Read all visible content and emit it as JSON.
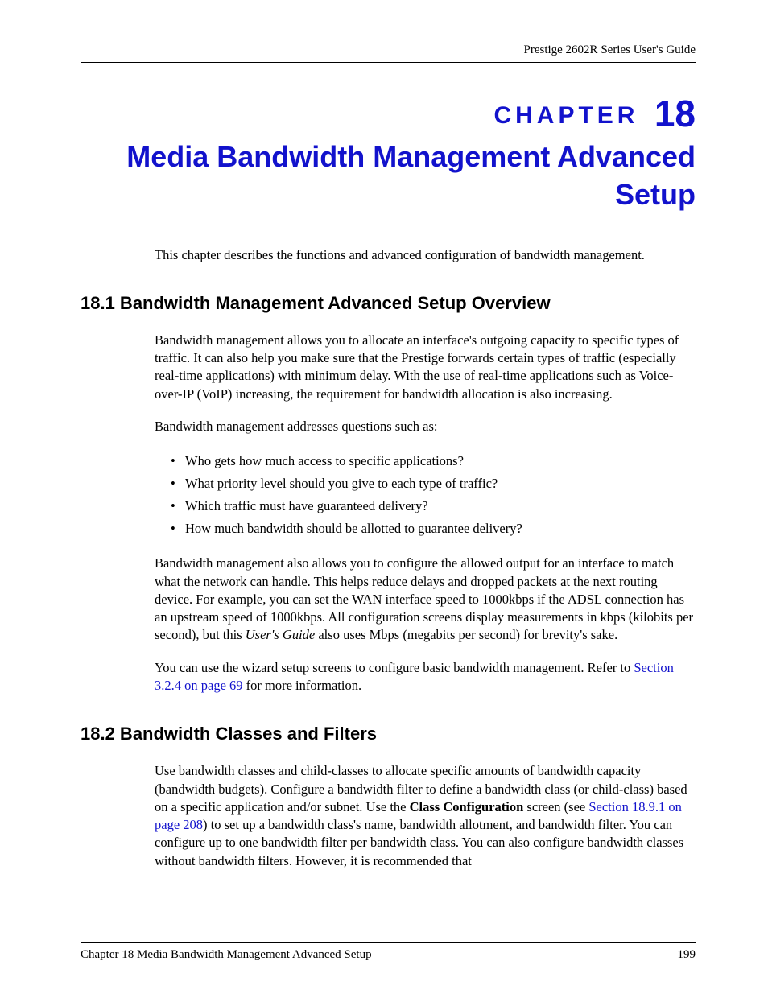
{
  "header": {
    "guide_title": "Prestige 2602R Series User's Guide"
  },
  "chapter": {
    "label_word": "CHAPTER",
    "number": "18",
    "title": "Media Bandwidth Management Advanced Setup",
    "intro": "This chapter describes the functions and advanced configuration of bandwidth management."
  },
  "section_18_1": {
    "heading": "18.1  Bandwidth Management Advanced Setup Overview",
    "p1": "Bandwidth management allows you to allocate an interface's outgoing capacity to specific types of traffic. It can also help you make sure that the Prestige forwards certain types of traffic (especially real-time applications) with minimum delay. With the use of real-time applications such as Voice-over-IP (VoIP) increasing, the requirement for bandwidth allocation is also increasing.",
    "p2": "Bandwidth management addresses questions such as:",
    "bullets": [
      "Who gets how much access to specific applications?",
      "What priority level should you give to each type of traffic?",
      "Which traffic must have guaranteed delivery?",
      "How much bandwidth should be allotted to guarantee delivery?"
    ],
    "p3_a": "Bandwidth management also allows you to configure the allowed output for an interface to match what the network can handle. This helps reduce delays and dropped packets at the next routing device. For example, you can set the WAN interface speed to 1000kbps if the ADSL connection has an upstream speed of 1000kbps. All configuration screens display measurements in kbps (kilobits per second), but this ",
    "p3_italic": "User's Guide",
    "p3_b": " also uses Mbps (megabits per second) for brevity's sake.",
    "p4_a": "You can use the wizard setup screens to configure basic bandwidth management. Refer to ",
    "p4_link": "Section 3.2.4 on page 69",
    "p4_b": " for more information."
  },
  "section_18_2": {
    "heading": "18.2  Bandwidth Classes and Filters",
    "p1_a": "Use bandwidth classes and child-classes to allocate specific amounts of bandwidth capacity (bandwidth budgets). Configure a bandwidth filter to define a bandwidth class (or child-class) based on a specific application and/or subnet. Use the ",
    "p1_bold": "Class Configuration",
    "p1_b": " screen (see ",
    "p1_link": "Section 18.9.1 on page 208",
    "p1_c": ") to set up a bandwidth class's name, bandwidth allotment, and bandwidth filter. You can configure up to one bandwidth filter per bandwidth class. You can also configure bandwidth classes without bandwidth filters. However, it is recommended that"
  },
  "footer": {
    "left": "Chapter 18 Media Bandwidth Management Advanced Setup",
    "right": "199"
  }
}
